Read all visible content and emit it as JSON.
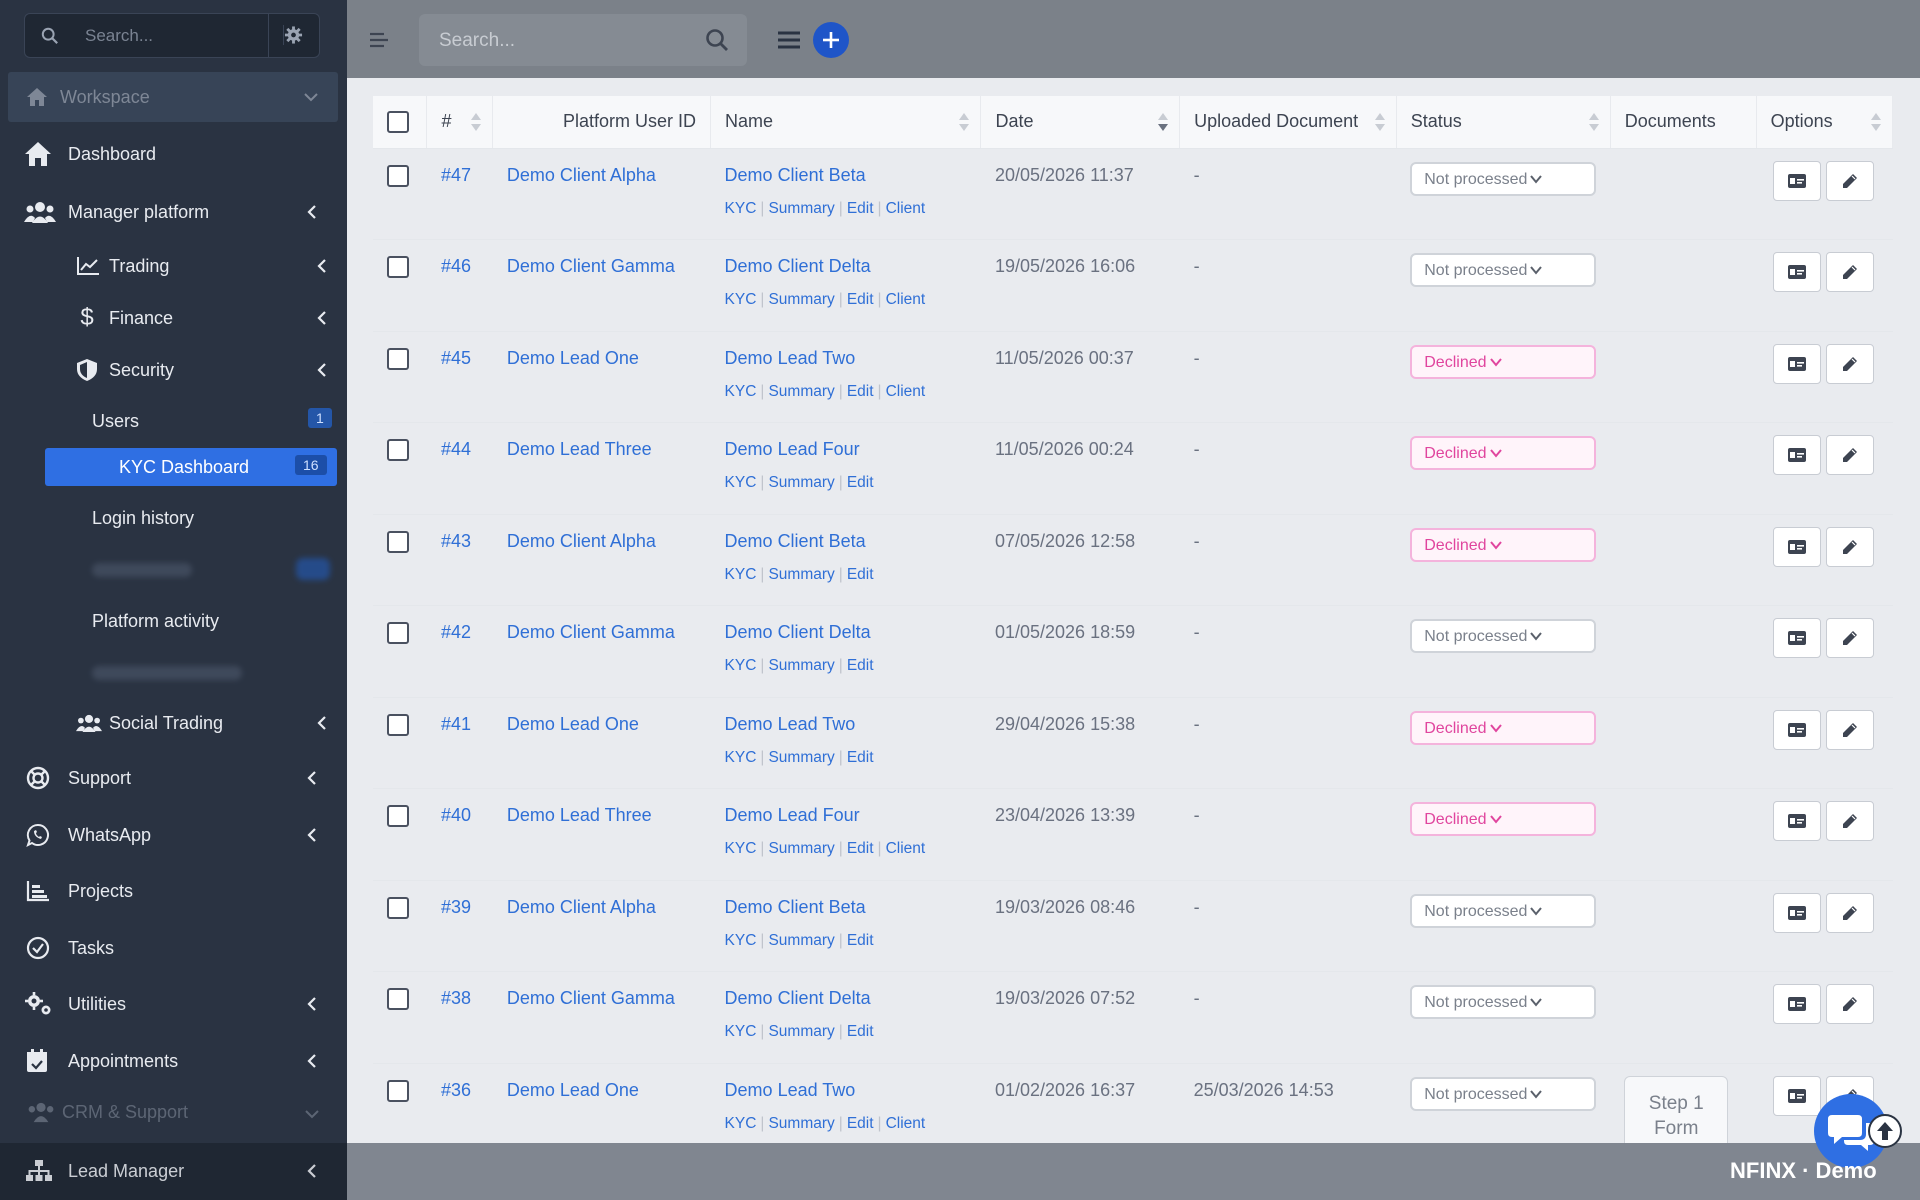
{
  "sidebar": {
    "search_placeholder": "Search...",
    "workspace": "Workspace",
    "dashboard": "Dashboard",
    "manager_platform": "Manager platform",
    "trading": "Trading",
    "finance": "Finance",
    "security": "Security",
    "users": "Users",
    "users_count": "1",
    "kyc_dashboard": "KYC Dashboard",
    "kyc_count": "16",
    "login_history": "Login history",
    "platform_activity": "Platform activity",
    "social_trading": "Social Trading",
    "support": "Support",
    "whatsapp": "WhatsApp",
    "projects": "Projects",
    "tasks": "Tasks",
    "utilities": "Utilities",
    "appointments": "Appointments",
    "crm_support": "CRM & Support",
    "lead_manager": "Lead Manager"
  },
  "topbar": {
    "search_placeholder": "Search..."
  },
  "table": {
    "headers": {
      "num": "#",
      "platform_user_id": "Platform User ID",
      "name": "Name",
      "date": "Date",
      "uploaded_document": "Uploaded Document",
      "status": "Status",
      "documents": "Documents",
      "options": "Options"
    },
    "link_labels": {
      "kyc": "KYC",
      "summary": "Summary",
      "edit": "Edit",
      "client": "Client"
    },
    "rows": [
      {
        "id": "#47",
        "user": "Demo Client Alpha",
        "name": "Demo Client Beta",
        "date": "20/05/2026 11:37",
        "uploaded": "-",
        "status": "Not processed",
        "client": true,
        "doc": ""
      },
      {
        "id": "#46",
        "user": "Demo Client Gamma",
        "name": "Demo Client Delta",
        "date": "19/05/2026 16:06",
        "uploaded": "-",
        "status": "Not processed",
        "client": true,
        "doc": ""
      },
      {
        "id": "#45",
        "user": "Demo Lead One",
        "name": "Demo Lead Two",
        "date": "11/05/2026 00:37",
        "uploaded": "-",
        "status": "Declined",
        "client": true,
        "doc": ""
      },
      {
        "id": "#44",
        "user": "Demo Lead Three",
        "name": "Demo Lead Four",
        "date": "11/05/2026 00:24",
        "uploaded": "-",
        "status": "Declined",
        "client": false,
        "doc": ""
      },
      {
        "id": "#43",
        "user": "Demo Client Alpha",
        "name": "Demo Client Beta",
        "date": "07/05/2026 12:58",
        "uploaded": "-",
        "status": "Declined",
        "client": false,
        "doc": ""
      },
      {
        "id": "#42",
        "user": "Demo Client Gamma",
        "name": "Demo Client Delta",
        "date": "01/05/2026 18:59",
        "uploaded": "-",
        "status": "Not processed",
        "client": false,
        "doc": ""
      },
      {
        "id": "#41",
        "user": "Demo Lead One",
        "name": "Demo Lead Two",
        "date": "29/04/2026 15:38",
        "uploaded": "-",
        "status": "Declined",
        "client": false,
        "doc": ""
      },
      {
        "id": "#40",
        "user": "Demo Lead Three",
        "name": "Demo Lead Four",
        "date": "23/04/2026 13:39",
        "uploaded": "-",
        "status": "Declined",
        "client": true,
        "doc": ""
      },
      {
        "id": "#39",
        "user": "Demo Client Alpha",
        "name": "Demo Client Beta",
        "date": "19/03/2026 08:46",
        "uploaded": "-",
        "status": "Not processed",
        "client": false,
        "doc": ""
      },
      {
        "id": "#38",
        "user": "Demo Client Gamma",
        "name": "Demo Client Delta",
        "date": "19/03/2026 07:52",
        "uploaded": "-",
        "status": "Not processed",
        "client": false,
        "doc": ""
      },
      {
        "id": "#36",
        "user": "Demo Lead One",
        "name": "Demo Lead Two",
        "date": "01/02/2026 16:37",
        "uploaded": "25/03/2026 14:53",
        "status": "Not processed",
        "client": true,
        "doc": "Step 1 Form"
      }
    ]
  },
  "brand": "NFINX · Demo",
  "colors": {
    "sidebar_bg": "#2a3342",
    "accent": "#2f6fe3",
    "link": "#2f6fd6",
    "declined": "#e0459e"
  }
}
